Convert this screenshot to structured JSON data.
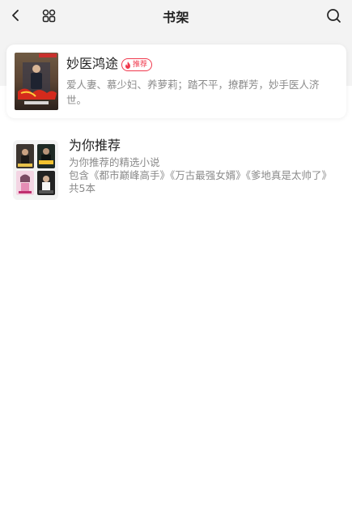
{
  "header": {
    "title": "书架",
    "icons": [
      "back-icon",
      "grid-icon",
      "search-icon"
    ]
  },
  "featured": {
    "title": "妙医鸿途",
    "badge": "推荐",
    "description": "爱人妻、慕少妇、养萝莉；踏不平，撩群芳，妙手医人济世。"
  },
  "recommend": {
    "title": "为你推荐",
    "subtitle": "为你推荐的精选小说",
    "contains": "包含《都市巅峰高手》《万古最强女婿》《爹地真是太帅了》",
    "count": "共5本"
  },
  "colors": {
    "accent": "#f0394d",
    "band": "#f3f3f3",
    "text_primary": "#222222",
    "text_secondary": "#8a8a8a"
  }
}
